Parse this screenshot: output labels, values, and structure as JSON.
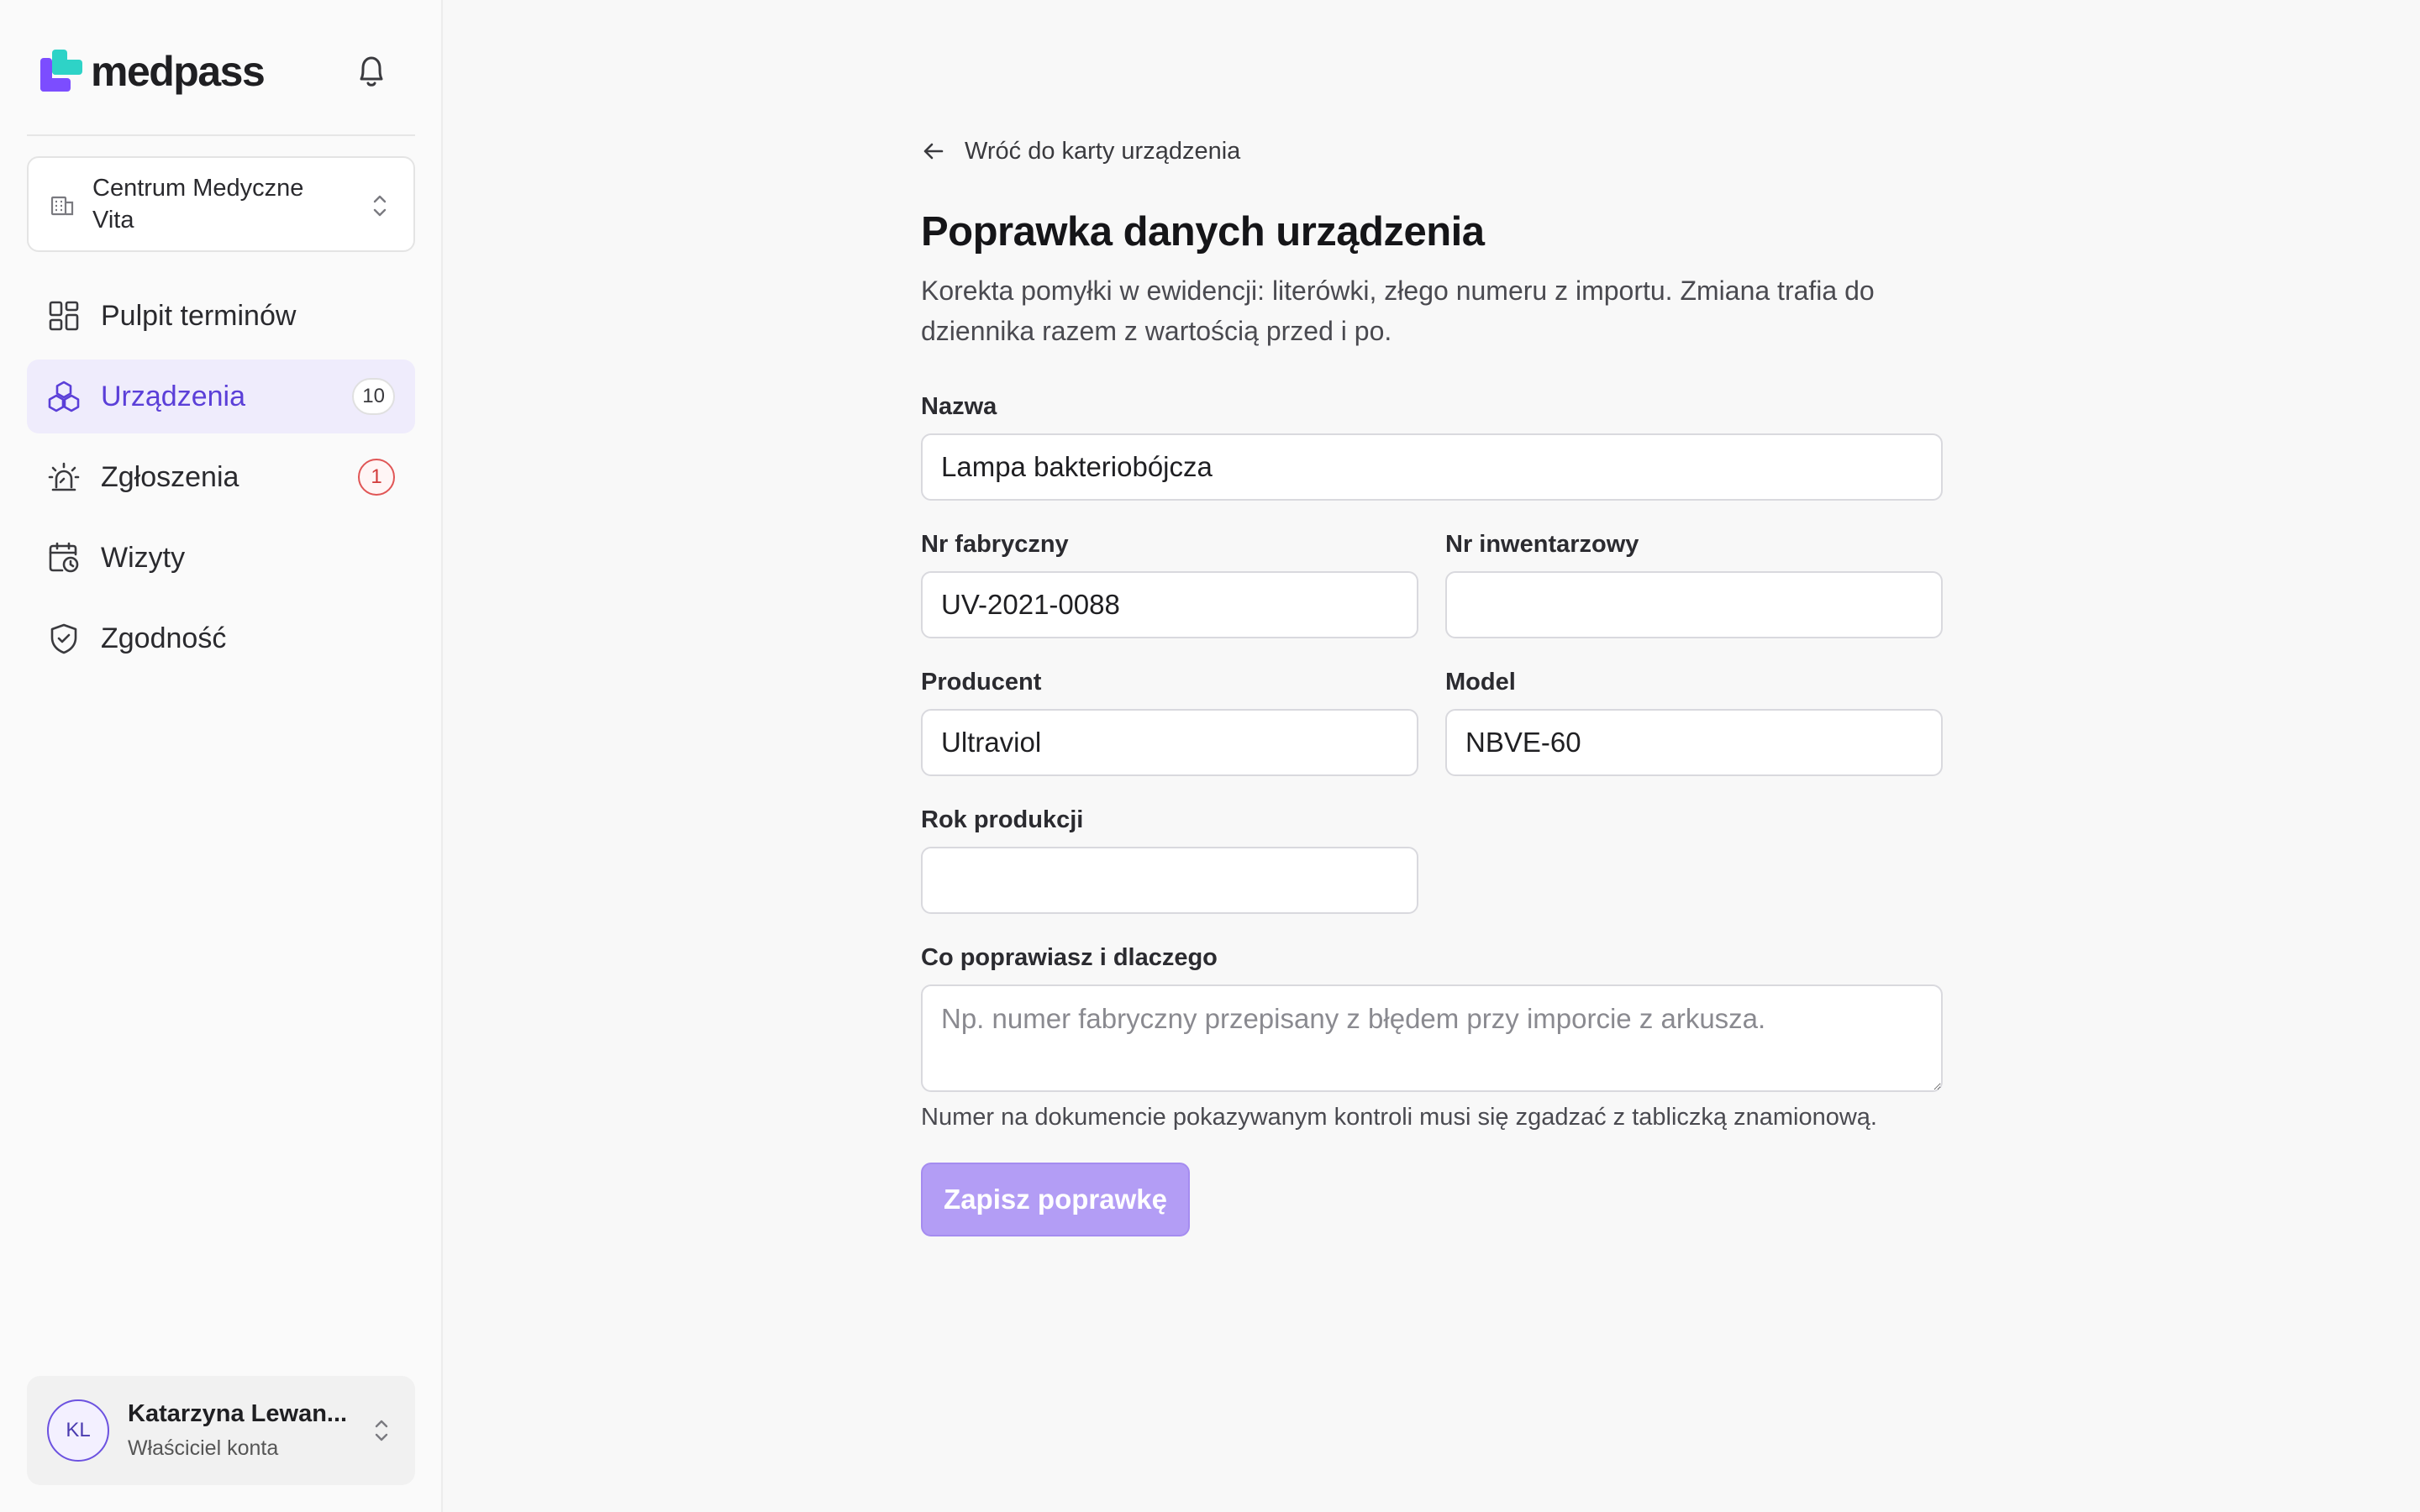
{
  "brand": {
    "name": "medpass",
    "logo_colors": [
      "#7c4dff",
      "#2ed3c7"
    ]
  },
  "sidebar": {
    "organization": "Centrum Medyczne Vita",
    "nav": [
      {
        "label": "Pulpit terminów",
        "icon": "dashboard-icon",
        "active": false
      },
      {
        "label": "Urządzenia",
        "icon": "devices-icon",
        "active": true,
        "badge": "10"
      },
      {
        "label": "Zgłoszenia",
        "icon": "alarm-icon",
        "active": false,
        "badge": "1"
      },
      {
        "label": "Wizyty",
        "icon": "calendar-clock-icon",
        "active": false
      },
      {
        "label": "Zgodność",
        "icon": "shield-check-icon",
        "active": false
      }
    ],
    "user": {
      "initials": "KL",
      "name": "Katarzyna Lewan...",
      "role": "Właściciel konta"
    }
  },
  "main": {
    "back_label": "Wróć do karty urządzenia",
    "title": "Poprawka danych urządzenia",
    "description": "Korekta pomyłki w ewidencji: literówki, złego numeru z importu. Zmiana trafia do dziennika razem z wartością przed i po.",
    "form": {
      "name": {
        "label": "Nazwa",
        "value": "Lampa bakteriobójcza"
      },
      "serial": {
        "label": "Nr fabryczny",
        "value": "UV-2021-0088"
      },
      "inventory": {
        "label": "Nr inwentarzowy",
        "value": ""
      },
      "manufacturer": {
        "label": "Producent",
        "value": "Ultraviol"
      },
      "model": {
        "label": "Model",
        "value": "NBVE-60"
      },
      "year": {
        "label": "Rok produkcji",
        "value": ""
      },
      "reason": {
        "label": "Co poprawiasz i dlaczego",
        "placeholder": "Np. numer fabryczny przepisany z błędem przy imporcie z arkusza."
      },
      "hint": "Numer na dokumencie pokazywanym kontroli musi się zgadzać z tabliczką znamionową.",
      "save_label": "Zapisz poprawkę"
    }
  },
  "colors": {
    "accent": "#5b3fd8",
    "accent_bg": "#efecfc",
    "button_disabled": "#b39df5",
    "alert": "#d23a3a"
  }
}
